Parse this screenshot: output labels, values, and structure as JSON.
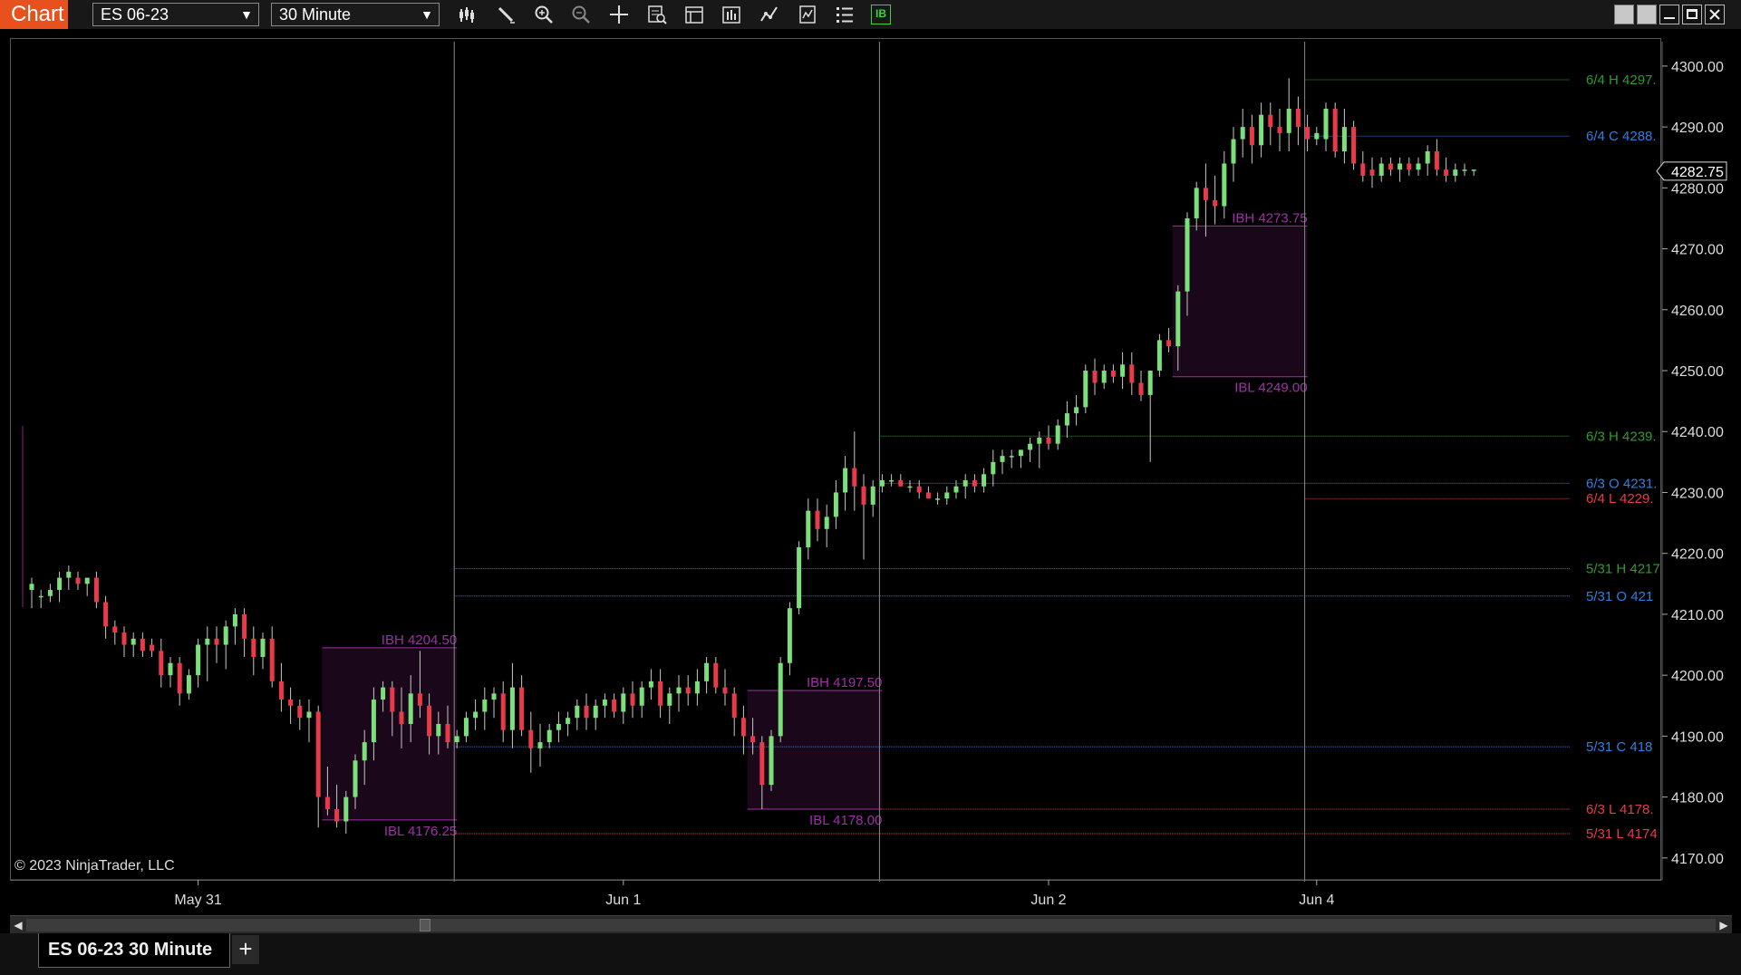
{
  "window": {
    "tab_label": "Chart",
    "instrument": "ES 06-23",
    "interval": "30 Minute",
    "toolbar_icons": [
      "bar-type-icon",
      "drawing-tool-icon",
      "zoom-in-icon",
      "zoom-out-icon",
      "crosshair-icon",
      "data-box-icon",
      "properties-icon",
      "templates-icon",
      "strategies-icon",
      "indicators-icon",
      "list-icon",
      "ib-icon"
    ],
    "toolbar_ib_label": "IB",
    "window_buttons": [
      "tile-icon",
      "detach-icon",
      "minimize-icon",
      "maximize-icon",
      "close-icon"
    ],
    "accent_color": "#e8511e"
  },
  "footer": {
    "copyright": "© 2023 NinjaTrader, LLC",
    "tab_label": "ES 06-23 30 Minute",
    "add_tab_label": "+"
  },
  "chart_data": {
    "type": "candlestick",
    "ylim": [
      4167,
      4304
    ],
    "y_ticks": [
      4170,
      4180,
      4190,
      4200,
      4210,
      4220,
      4230,
      4240,
      4250,
      4260,
      4270,
      4280,
      4290,
      4300
    ],
    "y_tick_labels": [
      "4170.00",
      "4180.00",
      "4190.00",
      "4200.00",
      "4210.00",
      "4220.00",
      "4230.00",
      "4240.00",
      "4250.00",
      "4260.00",
      "4270.00",
      "4280.00",
      "4290.00",
      "4300.00"
    ],
    "x_labels": [
      {
        "text": "May 31",
        "bar": 18
      },
      {
        "text": "Jun 1",
        "bar": 64
      },
      {
        "text": "Jun 2",
        "bar": 110
      },
      {
        "text": "Jun 4",
        "bar": 139
      }
    ],
    "session_separators": [
      46,
      92,
      138
    ],
    "last_price": "4282.75",
    "bullish_color": "#7be07b",
    "bearish_color": "#e83a4a",
    "candles": [
      [
        4214,
        4216,
        4211,
        4215
      ],
      [
        4213,
        4214,
        4211,
        4213
      ],
      [
        4213,
        4215,
        4212,
        4214
      ],
      [
        4214,
        4217,
        4212,
        4216
      ],
      [
        4216,
        4218,
        4214,
        4217
      ],
      [
        4216,
        4217,
        4214,
        4215
      ],
      [
        4215,
        4216,
        4213,
        4216
      ],
      [
        4216,
        4217,
        4211,
        4212
      ],
      [
        4212,
        4213,
        4206,
        4208
      ],
      [
        4208,
        4209,
        4205,
        4207
      ],
      [
        4207,
        4208,
        4203,
        4205
      ],
      [
        4205,
        4207,
        4203,
        4206
      ],
      [
        4206,
        4207,
        4203,
        4204
      ],
      [
        4205,
        4206,
        4203,
        4204
      ],
      [
        4204,
        4206,
        4198,
        4200
      ],
      [
        4200,
        4203,
        4198,
        4202
      ],
      [
        4202,
        4203,
        4195,
        4197
      ],
      [
        4197,
        4201,
        4196,
        4200
      ],
      [
        4200,
        4206,
        4198,
        4205
      ],
      [
        4205,
        4208,
        4199,
        4206
      ],
      [
        4206,
        4208,
        4202,
        4205
      ],
      [
        4205,
        4209,
        4201,
        4208
      ],
      [
        4208,
        4211,
        4205,
        4210
      ],
      [
        4210,
        4211,
        4203,
        4206
      ],
      [
        4206,
        4208,
        4200,
        4203
      ],
      [
        4203,
        4207,
        4201,
        4206
      ],
      [
        4206,
        4208,
        4198,
        4199
      ],
      [
        4199,
        4202,
        4194,
        4196
      ],
      [
        4196,
        4198,
        4192,
        4195
      ],
      [
        4195,
        4196,
        4191,
        4193
      ],
      [
        4193,
        4196,
        4189,
        4194
      ],
      [
        4194,
        4195,
        4175,
        4180
      ],
      [
        4180,
        4185,
        4177,
        4178
      ],
      [
        4178,
        4182,
        4175,
        4176
      ],
      [
        4176,
        4181,
        4174,
        4180
      ],
      [
        4180,
        4187,
        4178,
        4186
      ],
      [
        4186,
        4191,
        4182,
        4189
      ],
      [
        4189,
        4198,
        4186,
        4196
      ],
      [
        4196,
        4199,
        4194,
        4198
      ],
      [
        4198,
        4199,
        4190,
        4194
      ],
      [
        4194,
        4198,
        4188,
        4192
      ],
      [
        4192,
        4200,
        4189,
        4197
      ],
      [
        4197,
        4204,
        4193,
        4195
      ],
      [
        4195,
        4197,
        4187,
        4190
      ],
      [
        4190,
        4194,
        4187,
        4192
      ],
      [
        4192,
        4195,
        4188,
        4189
      ],
      [
        4189,
        4191,
        4188,
        4190
      ],
      [
        4190,
        4194,
        4189,
        4193
      ],
      [
        4193,
        4196,
        4191,
        4194
      ],
      [
        4194,
        4198,
        4191,
        4196
      ],
      [
        4196,
        4198,
        4193,
        4197
      ],
      [
        4197,
        4199,
        4189,
        4191
      ],
      [
        4191,
        4202,
        4188,
        4198
      ],
      [
        4198,
        4200,
        4190,
        4191
      ],
      [
        4191,
        4194,
        4184,
        4188
      ],
      [
        4188,
        4192,
        4185,
        4189
      ],
      [
        4189,
        4192,
        4188,
        4191
      ],
      [
        4191,
        4194,
        4189,
        4192
      ],
      [
        4192,
        4194,
        4190,
        4193
      ],
      [
        4193,
        4196,
        4191,
        4195
      ],
      [
        4195,
        4197,
        4191,
        4193
      ],
      [
        4193,
        4196,
        4191,
        4195
      ],
      [
        4195,
        4197,
        4193,
        4196
      ],
      [
        4196,
        4197,
        4193,
        4194
      ],
      [
        4194,
        4198,
        4192,
        4197
      ],
      [
        4197,
        4199,
        4193,
        4195
      ],
      [
        4195,
        4199,
        4193,
        4198
      ],
      [
        4198,
        4201,
        4196,
        4199
      ],
      [
        4199,
        4201,
        4193,
        4195
      ],
      [
        4195,
        4198,
        4192,
        4197
      ],
      [
        4197,
        4200,
        4194,
        4198
      ],
      [
        4198,
        4200,
        4195,
        4197
      ],
      [
        4197,
        4201,
        4195,
        4199
      ],
      [
        4199,
        4203,
        4197,
        4202
      ],
      [
        4202,
        4203,
        4197,
        4198
      ],
      [
        4198,
        4201,
        4195,
        4197
      ],
      [
        4197,
        4198,
        4190,
        4193
      ],
      [
        4193,
        4195,
        4187,
        4190
      ],
      [
        4190,
        4193,
        4187,
        4189
      ],
      [
        4189,
        4190,
        4178,
        4182
      ],
      [
        4182,
        4191,
        4181,
        4190
      ],
      [
        4190,
        4203,
        4189,
        4202
      ],
      [
        4202,
        4212,
        4200,
        4211
      ],
      [
        4211,
        4222,
        4210,
        4221
      ],
      [
        4221,
        4229,
        4219,
        4227
      ],
      [
        4227,
        4229,
        4222,
        4224
      ],
      [
        4224,
        4228,
        4221,
        4226
      ],
      [
        4226,
        4232,
        4224,
        4230
      ],
      [
        4230,
        4236,
        4227,
        4234
      ],
      [
        4234,
        4240,
        4227,
        4231
      ],
      [
        4231,
        4233,
        4219,
        4228
      ],
      [
        4228,
        4232,
        4226,
        4231
      ],
      [
        4231,
        4233,
        4230,
        4232
      ],
      [
        4232,
        4233,
        4231,
        4232
      ],
      [
        4232,
        4233,
        4231,
        4231
      ],
      [
        4231,
        4232,
        4230,
        4231
      ],
      [
        4231,
        4232,
        4229,
        4230
      ],
      [
        4230,
        4231,
        4229,
        4229
      ],
      [
        4229,
        4230,
        4228,
        4229
      ],
      [
        4229,
        4231,
        4228,
        4230
      ],
      [
        4230,
        4232,
        4229,
        4231
      ],
      [
        4231,
        4233,
        4229,
        4232
      ],
      [
        4232,
        4233,
        4230,
        4231
      ],
      [
        4231,
        4234,
        4230,
        4233
      ],
      [
        4233,
        4237,
        4231,
        4235
      ],
      [
        4235,
        4237,
        4233,
        4236
      ],
      [
        4236,
        4237,
        4234,
        4236
      ],
      [
        4236,
        4237,
        4234,
        4237
      ],
      [
        4237,
        4239,
        4235,
        4238
      ],
      [
        4238,
        4240,
        4234,
        4239
      ],
      [
        4239,
        4241,
        4237,
        4238
      ],
      [
        4238,
        4242,
        4237,
        4241
      ],
      [
        4241,
        4245,
        4239,
        4243
      ],
      [
        4243,
        4246,
        4241,
        4244
      ],
      [
        4244,
        4251,
        4243,
        4250
      ],
      [
        4250,
        4252,
        4246,
        4248
      ],
      [
        4248,
        4251,
        4247,
        4250
      ],
      [
        4250,
        4251,
        4248,
        4249
      ],
      [
        4249,
        4253,
        4247,
        4251
      ],
      [
        4251,
        4253,
        4246,
        4248
      ],
      [
        4248,
        4250,
        4245,
        4246
      ],
      [
        4246,
        4249,
        4235,
        4250
      ],
      [
        4250,
        4256,
        4249,
        4255
      ],
      [
        4255,
        4257,
        4253,
        4254
      ],
      [
        4254,
        4264,
        4250,
        4263
      ],
      [
        4263,
        4276,
        4259,
        4275
      ],
      [
        4275,
        4281,
        4273,
        4280
      ],
      [
        4280,
        4284,
        4272,
        4278
      ],
      [
        4278,
        4282,
        4274,
        4277
      ],
      [
        4277,
        4286,
        4275,
        4284
      ],
      [
        4284,
        4290,
        4281,
        4288
      ],
      [
        4288,
        4293,
        4285,
        4290
      ],
      [
        4290,
        4292,
        4284,
        4287
      ],
      [
        4287,
        4294,
        4285,
        4292
      ],
      [
        4292,
        4294,
        4287,
        4290
      ],
      [
        4290,
        4293,
        4286,
        4289
      ],
      [
        4289,
        4298,
        4286,
        4293
      ],
      [
        4293,
        4295,
        4287,
        4290
      ],
      [
        4290,
        4292,
        4286,
        4288
      ],
      [
        4288,
        4290,
        4287,
        4289
      ],
      [
        4288,
        4294,
        4286,
        4293
      ],
      [
        4293,
        4294,
        4285,
        4286
      ],
      [
        4286,
        4293,
        4284,
        4290
      ],
      [
        4290,
        4291,
        4283,
        4284
      ],
      [
        4284,
        4286,
        4281,
        4282
      ],
      [
        4283,
        4285,
        4280,
        4282
      ],
      [
        4282,
        4285,
        4281,
        4284
      ],
      [
        4284,
        4285,
        4282,
        4283
      ],
      [
        4283,
        4285,
        4281,
        4284
      ],
      [
        4284,
        4285,
        4282,
        4283
      ],
      [
        4283,
        4285,
        4282,
        4284
      ],
      [
        4284,
        4287,
        4282,
        4286
      ],
      [
        4286,
        4288,
        4282,
        4283
      ],
      [
        4283,
        4285,
        4281,
        4282
      ],
      [
        4282,
        4284,
        4281,
        4283
      ],
      [
        4283,
        4284,
        4282,
        4283
      ],
      [
        4283,
        4283,
        4282,
        4283
      ]
    ],
    "ib_boxes": [
      {
        "start": 32,
        "end": 46,
        "high": 4204.5,
        "low": 4176.25,
        "high_label": "IBH 4204.50",
        "low_label": "IBL 4176.25"
      },
      {
        "start": 78,
        "end": 92,
        "high": 4197.5,
        "low": 4178.0,
        "high_label": "IBH 4197.50",
        "low_label": "IBL 4178.00"
      },
      {
        "start": 124,
        "end": 138,
        "high": 4273.75,
        "low": 4249.0,
        "high_label": "IBH 4273.75",
        "low_label": "IBL 4249.00"
      }
    ],
    "ib_color": "#a02fa8",
    "level_lines": [
      {
        "from": 138,
        "y": 4297.75,
        "label": "6/4 H 4297.",
        "color": "#2f9a2f"
      },
      {
        "from": 138,
        "y": 4288.5,
        "label": "6/4 C 4288.",
        "color": "#2f7fe0"
      },
      {
        "from": 92,
        "y": 4239.25,
        "label": "6/3 H 4239.",
        "color": "#2f9a2f"
      },
      {
        "from": 92,
        "y": 4231.5,
        "label": "6/3 O 4231.",
        "color": "#2f7fe0"
      },
      {
        "from": 138,
        "y": 4229.0,
        "label": "6/4 L 4229.",
        "color": "#e83a4a"
      },
      {
        "from": 46,
        "y": 4217.5,
        "label": "5/31 H 4217",
        "color": "#2f9a2f"
      },
      {
        "from": 46,
        "y": 4213.0,
        "label": "5/31 O 421",
        "color": "#2f7fe0"
      },
      {
        "from": 46,
        "y": 4188.25,
        "label": "5/31 C 418",
        "color": "#2f7fe0"
      },
      {
        "from": 92,
        "y": 4178.0,
        "label": "6/3 L 4178.",
        "color": "#e83a4a"
      },
      {
        "from": 46,
        "y": 4174.0,
        "label": "5/31 L 4174",
        "color": "#e83a4a"
      }
    ]
  }
}
